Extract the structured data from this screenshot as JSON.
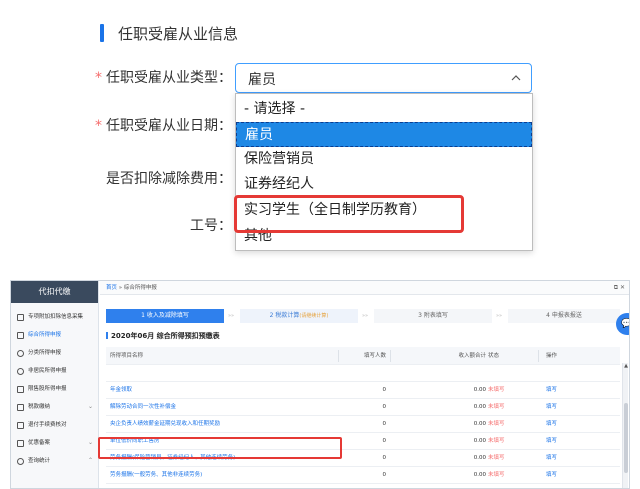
{
  "form": {
    "section_title": "任职受雇从业信息",
    "fields": [
      {
        "required": true,
        "label": "任职受雇从业类型："
      },
      {
        "required": true,
        "label": "任职受雇从业日期："
      },
      {
        "required": false,
        "label": "是否扣除减除费用："
      },
      {
        "required": false,
        "label": "工号："
      }
    ],
    "select_value": "雇员",
    "options": [
      "- 请选择 -",
      "雇员",
      "保险营销员",
      "证券经纪人",
      "实习学生（全日制学历教育）",
      "其他"
    ],
    "selected_index": 1,
    "required_mark": "*"
  },
  "app": {
    "sidebar_title": "代扣代缴",
    "sidebar_items": [
      {
        "label": "专项附加扣除信息采集",
        "icon": "list-icon"
      },
      {
        "label": "综合所得申报",
        "icon": "layers-icon",
        "active": true
      },
      {
        "label": "分类所得申报",
        "icon": "clock-icon"
      },
      {
        "label": "非居民所得申报",
        "icon": "user-icon"
      },
      {
        "label": "限售股所得申报",
        "icon": "chart-icon"
      },
      {
        "label": "税款缴纳",
        "icon": "folder-icon",
        "arrow": "⌄"
      },
      {
        "label": "退付手续费核对",
        "icon": "doc-icon"
      },
      {
        "label": "优惠备案",
        "icon": "file-icon",
        "arrow": "⌄"
      },
      {
        "label": "查询统计",
        "icon": "search-icon",
        "arrow": "⌃"
      }
    ],
    "breadcrumb": {
      "home": "首页",
      "sep": "»",
      "current": "综合所得申报"
    },
    "window_btns": "⧉ ✕",
    "steps": [
      {
        "label": "1 收入及减除填写",
        "state": "active"
      },
      {
        "label": "2 税款计算",
        "sub": "(请继续计算)",
        "state": "pending"
      },
      {
        "label": "3 附表填写",
        "state": "idle"
      },
      {
        "label": "4 申报表报送",
        "state": "idle"
      }
    ],
    "step_sep": "»»",
    "page_heading": "2020年06月  综合所得预扣预缴表",
    "columns": [
      "所得项目名称",
      "填写人数",
      "收入额合计",
      "状态",
      "操作"
    ],
    "rows": [
      {
        "name": "",
        "count": "",
        "amount": "",
        "status": "",
        "op": ""
      },
      {
        "name": "年金领取",
        "count": "0",
        "amount": "0.00",
        "status": "未填写",
        "op": "填写"
      },
      {
        "name": "解除劳动合同一次性补偿金",
        "count": "0",
        "amount": "0.00",
        "status": "未填写",
        "op": "填写"
      },
      {
        "name": "央企负责人绩效薪金延期兑现收入和任期奖励",
        "count": "0",
        "amount": "0.00",
        "status": "未填写",
        "op": "填写"
      },
      {
        "name": "单位低价向职工售房",
        "count": "0",
        "amount": "0.00",
        "status": "未填写",
        "op": "填写"
      },
      {
        "name": "劳务报酬(保险营销员、证券经纪人、其他连续劳务)",
        "count": "0",
        "amount": "0.00",
        "status": "未填写",
        "op": "填写"
      },
      {
        "name": "劳务报酬(一般劳务、其他非连续劳务)",
        "count": "0",
        "amount": "0.00",
        "status": "未填写",
        "op": "填写"
      }
    ],
    "chat_icon_glyph": "💬",
    "scroll_up_glyph": "▲"
  }
}
